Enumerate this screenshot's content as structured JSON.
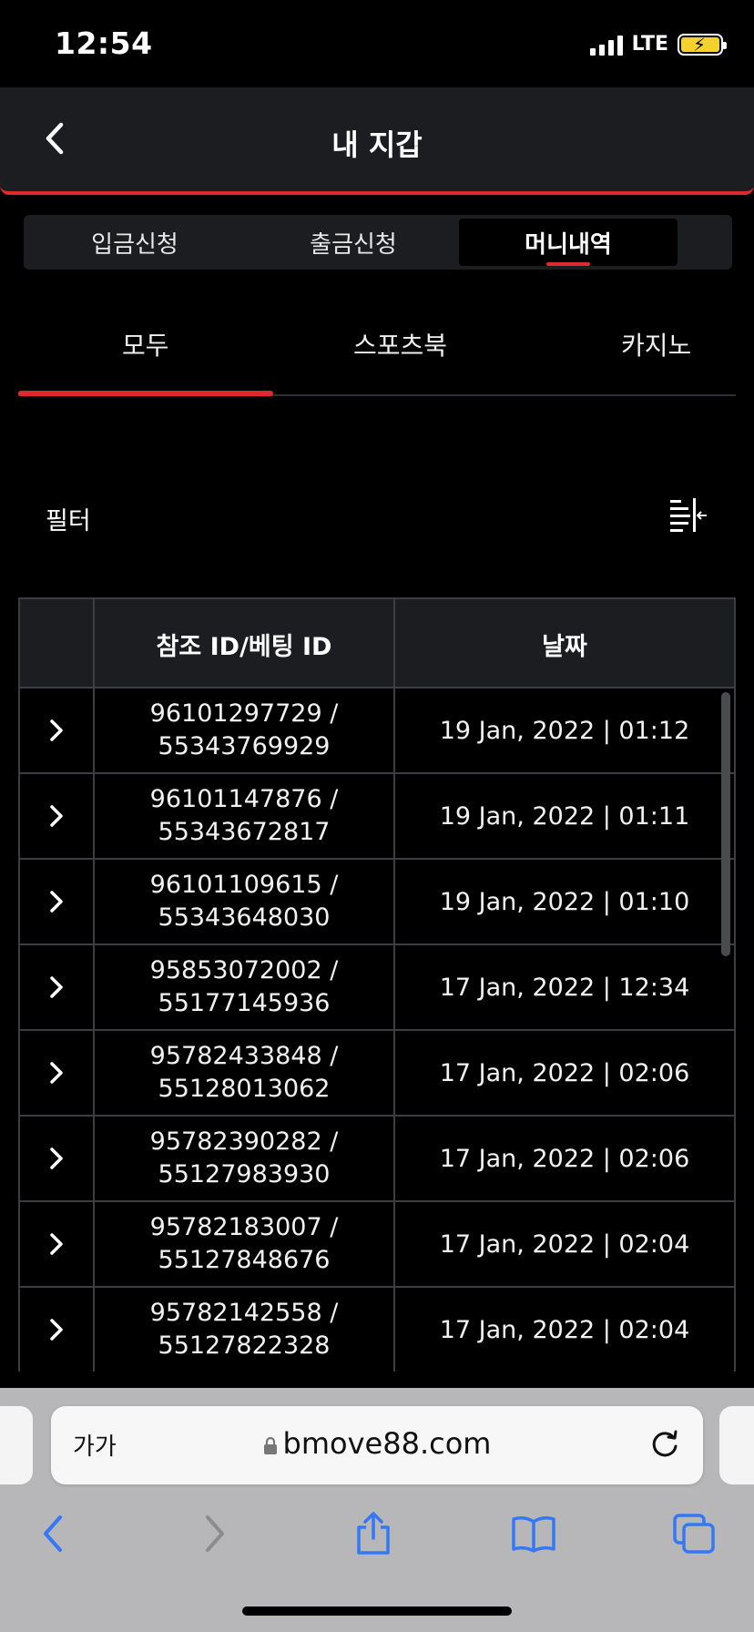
{
  "status_bar": {
    "time": "12:54",
    "network": "LTE"
  },
  "header": {
    "title": "내 지갑"
  },
  "segment_tabs": [
    {
      "label": "입금신청",
      "active": false
    },
    {
      "label": "출금신청",
      "active": false
    },
    {
      "label": "머니내역",
      "active": true
    }
  ],
  "category_tabs": [
    {
      "label": "모두",
      "active": true
    },
    {
      "label": "스포츠북",
      "active": false
    },
    {
      "label": "카지노",
      "active": false
    }
  ],
  "filter": {
    "label": "필터"
  },
  "table": {
    "columns": [
      "",
      "참조 ID/베팅 ID",
      "날짜"
    ],
    "rows": [
      {
        "id_line1": "96101297729 /",
        "id_line2": "55343769929",
        "date": "19 Jan, 2022 | 01:12"
      },
      {
        "id_line1": "96101147876 /",
        "id_line2": "55343672817",
        "date": "19 Jan, 2022 | 01:11"
      },
      {
        "id_line1": "96101109615 /",
        "id_line2": "55343648030",
        "date": "19 Jan, 2022 | 01:10"
      },
      {
        "id_line1": "95853072002 /",
        "id_line2": "55177145936",
        "date": "17 Jan, 2022 | 12:34"
      },
      {
        "id_line1": "95782433848 /",
        "id_line2": "55128013062",
        "date": "17 Jan, 2022 | 02:06"
      },
      {
        "id_line1": "95782390282 /",
        "id_line2": "55127983930",
        "date": "17 Jan, 2022 | 02:06"
      },
      {
        "id_line1": "95782183007 /",
        "id_line2": "55127848676",
        "date": "17 Jan, 2022 | 02:04"
      },
      {
        "id_line1": "95782142558 /",
        "id_line2": "55127822328",
        "date": "17 Jan, 2022 | 02:04"
      }
    ]
  },
  "browser": {
    "aa_label": "가가",
    "url": "bmove88.com"
  },
  "colors": {
    "accent": "#e0292c",
    "panel": "#1c1d21",
    "background": "#000000",
    "toolbar": "#b7b7b9",
    "ios_blue": "#3478f6"
  }
}
